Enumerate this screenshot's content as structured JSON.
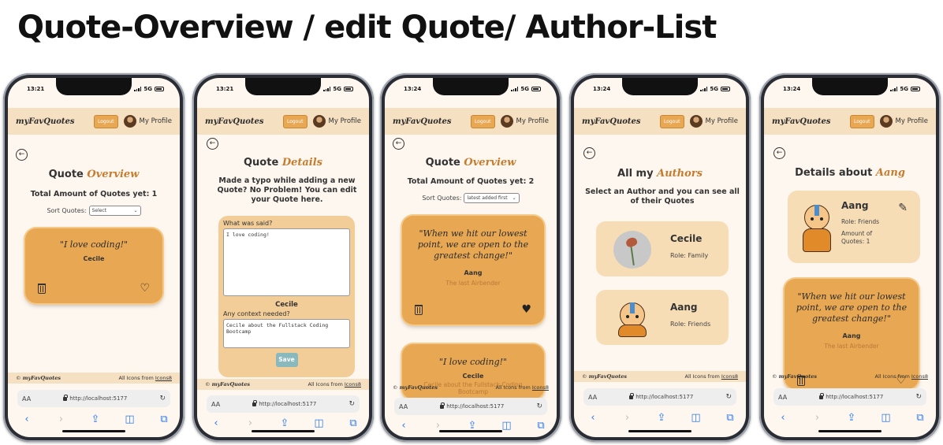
{
  "page_title": "Quote-Overview / edit Quote/ Author-List",
  "common": {
    "logo": "myFavQuotes",
    "logout": "Logout",
    "profile": "My Profile",
    "footer_logo": "myFavQuotes",
    "footer_icons_prefix": "All Icons from",
    "footer_icons_link": "Icons8",
    "url_aa": "AA",
    "url": "http://localhost:5177",
    "signal": "5G",
    "toolbar": {
      "back": "‹",
      "forward": "›",
      "share": "⇪",
      "book": "◫",
      "tabs": "⧉"
    }
  },
  "phones": [
    {
      "time": "13:21",
      "heading_plain": "Quote",
      "heading_accent": "Overview",
      "total": "Total Amount of Quotes yet: 1",
      "sort_label": "Sort Quotes:",
      "sort_value": "Select",
      "quote": {
        "text": "\"I love coding!\"",
        "author": "Cecile"
      }
    },
    {
      "time": "13:21",
      "heading_plain": "Quote",
      "heading_accent": "Details",
      "intro": "Made a typo while adding a new Quote? No Problem! You can edit your Quote here.",
      "said_label": "What was said?",
      "said_value": "I love coding!",
      "author": "Cecile",
      "context_label": "Any context needed?",
      "context_value": "Cecile about the Fullstack Coding Bootcamp",
      "save": "Save"
    },
    {
      "time": "13:24",
      "heading_plain": "Quote",
      "heading_accent": "Overview",
      "total": "Total Amount of Quotes yet: 2",
      "sort_label": "Sort Quotes:",
      "sort_value": "latest added first",
      "quote1": {
        "text": "\"When we hit our lowest point, we are open to the greatest change!\"",
        "author": "Aang",
        "context": "The last Airbender"
      },
      "quote2": {
        "text": "\"I love coding!\"",
        "author": "Cecile",
        "context": "Cecile about the Fullstack Coding Bootcamp"
      }
    },
    {
      "time": "13:24",
      "heading_plain": "All my",
      "heading_accent": "Authors",
      "intro": "Select an Author and you can see all of their Quotes",
      "authors": [
        {
          "name": "Cecile",
          "role": "Role: Family"
        },
        {
          "name": "Aang",
          "role": "Role: Friends"
        }
      ]
    },
    {
      "time": "13:24",
      "heading_plain": "Details about",
      "heading_accent": "Aang",
      "author": {
        "name": "Aang",
        "role": "Role: Friends",
        "amount": "Amount of Quotes: 1"
      },
      "quote": {
        "text": "\"When we hit our lowest point, we are open to the greatest change!\"",
        "author": "Aang",
        "context": "The last Airbender"
      }
    }
  ]
}
